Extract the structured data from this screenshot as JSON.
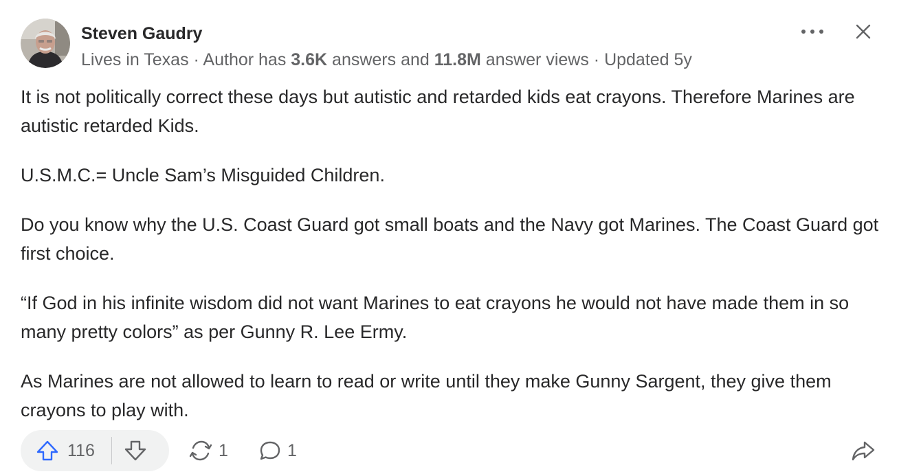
{
  "author": {
    "name": "Steven Gaudry",
    "credential": {
      "location": "Lives in Texas",
      "sep1": " · ",
      "prefix": "Author has ",
      "answers_count": "3.6K",
      "answers_text": " answers and ",
      "views_count": "11.8M",
      "views_text": " answer views",
      "sep2": " · ",
      "updated": "Updated 5y"
    }
  },
  "top_actions": {
    "more_icon": "more-horizontal-icon",
    "close_icon": "close-icon"
  },
  "paragraphs": [
    "It is not politically correct these days but autistic and retarded kids eat crayons. Therefore Marines are autistic retarded Kids.",
    "U.S.M.C.= Uncle Sam’s Misguided Children.",
    "Do you know why the U.S. Coast Guard got small boats and the Navy got Marines. The Coast Guard got first choice.",
    "“If God in his infinite wisdom did not want Marines to eat crayons he would not have made them in so many pretty colors” as per Gunny R. Lee Ermy.",
    "As Marines are not allowed to learn to read or write until they make Gunny Sargent, they give them crayons to play with."
  ],
  "actions": {
    "upvote_count": "116",
    "share_count": "1",
    "comment_count": "1"
  },
  "colors": {
    "upvote_accent": "#2e69ff",
    "text_primary": "#282829",
    "text_secondary": "#636466",
    "pill_bg": "#f1f2f2"
  }
}
